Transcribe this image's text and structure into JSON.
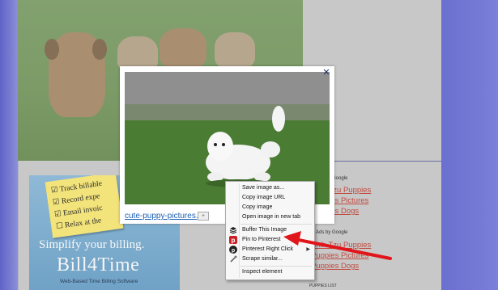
{
  "lightbox": {
    "caption": "cute-puppy-pictures.jpg",
    "close_label": "✕"
  },
  "sidebar": {
    "ads_label_1": "Ads by Google",
    "ads_label_2": "Ads by Google",
    "links_1": [
      "Shih Tzu Puppies",
      "Puppies Pictures",
      "Puppies Dogs"
    ],
    "links_2": [
      "Shih Tzu Puppies",
      "Puppies Pictures",
      "Puppies Dogs"
    ],
    "footer_label": "PUPPIES LIST"
  },
  "ad": {
    "note_lines": [
      "Track billable",
      "Record expe",
      "Email invoic",
      "Relax at the"
    ],
    "tagline": "Simplify your billing.",
    "brand": "Bill4Time",
    "subtitle": "Web-Based Time Billing Software"
  },
  "context_menu": {
    "items": [
      {
        "label": "Save image as..."
      },
      {
        "label": "Copy image URL"
      },
      {
        "label": "Copy image"
      },
      {
        "label": "Open image in new tab"
      },
      {
        "label": "Buffer This Image"
      },
      {
        "label": "Pin to Pinterest"
      },
      {
        "label": "Pinterest Right Click",
        "submenu": "▶"
      },
      {
        "label": "Scrape similar..."
      },
      {
        "label": "Inspect element"
      }
    ]
  },
  "colors": {
    "accent_arrow": "#e0161b",
    "link": "#c24a3f",
    "pinterest": "#cb2027"
  }
}
